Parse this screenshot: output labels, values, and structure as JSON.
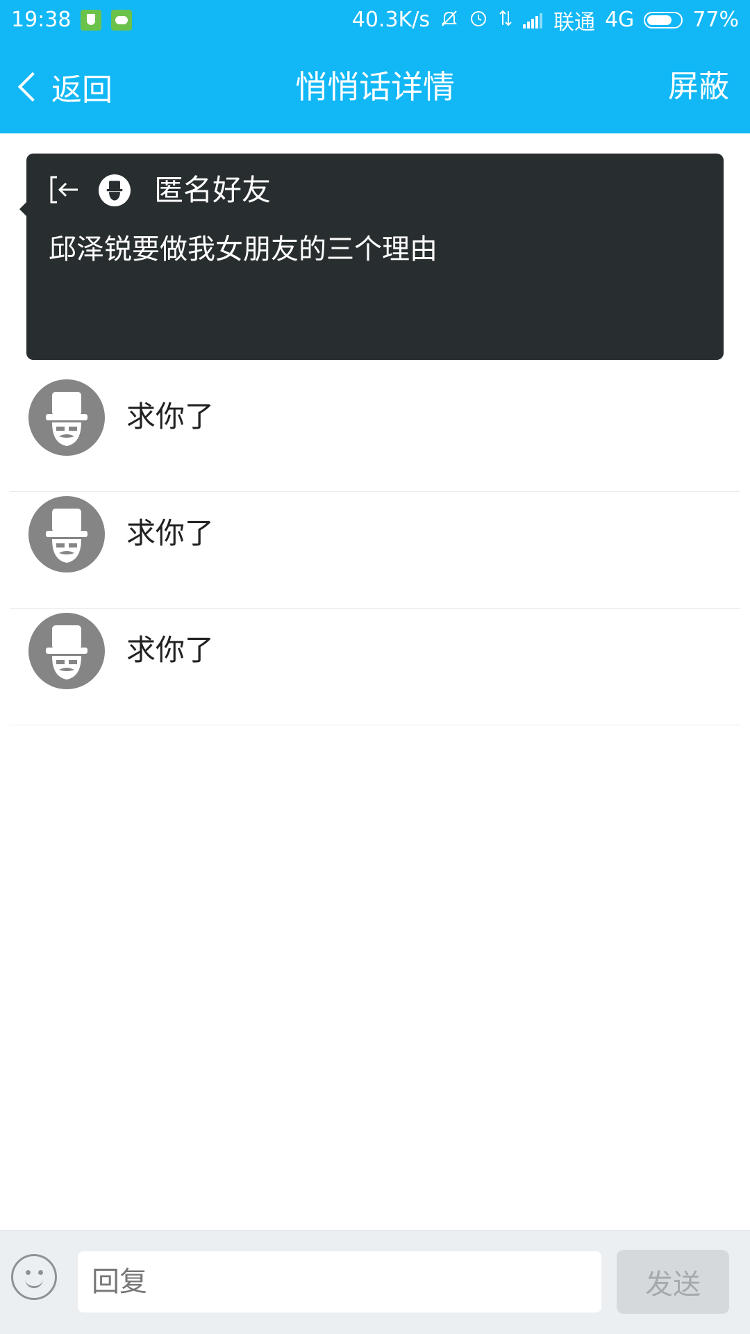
{
  "status_bar": {
    "time": "19:38",
    "net_speed": "40.3K/s",
    "carrier": "联通",
    "network_type": "4G",
    "battery_percent": "77%",
    "battery_level": 0.77,
    "icons": [
      "shield-notification-icon",
      "android-notification-icon",
      "mute-icon",
      "alarm-icon",
      "data-transfer-icon",
      "signal-icon",
      "battery-icon"
    ]
  },
  "nav": {
    "back_label": "返回",
    "title": "悄悄话详情",
    "block_label": "屏蔽"
  },
  "message": {
    "sender": "匿名好友",
    "text": "邱泽锐要做我女朋友的三个理由"
  },
  "replies": [
    {
      "text": "求你了"
    },
    {
      "text": "求你了"
    },
    {
      "text": "求你了"
    }
  ],
  "input_bar": {
    "placeholder": "回复",
    "send_label": "发送"
  },
  "colors": {
    "header": "#12b7f5",
    "card": "#282e2f",
    "avatar": "#868586",
    "send_disabled": "#d6d9dc"
  }
}
